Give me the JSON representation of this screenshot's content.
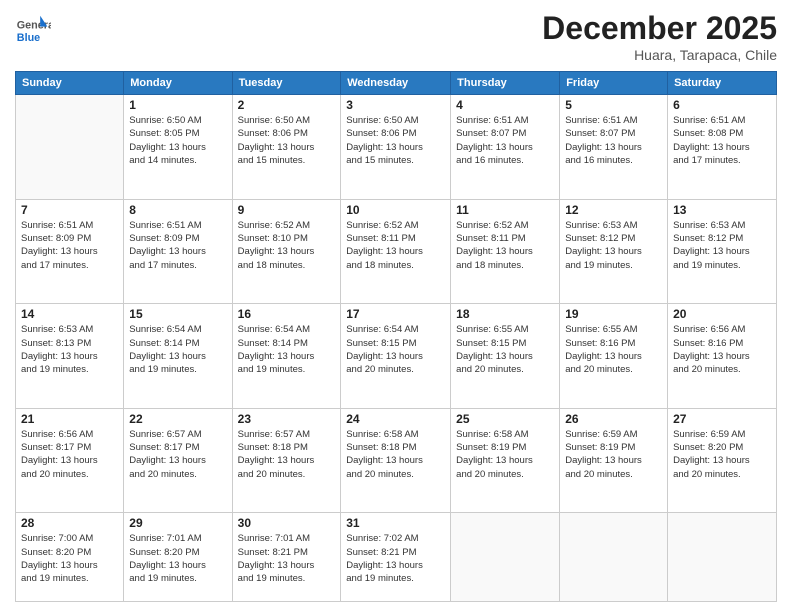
{
  "header": {
    "logo_general": "General",
    "logo_blue": "Blue",
    "month_title": "December 2025",
    "location": "Huara, Tarapaca, Chile"
  },
  "days_of_week": [
    "Sunday",
    "Monday",
    "Tuesday",
    "Wednesday",
    "Thursday",
    "Friday",
    "Saturday"
  ],
  "weeks": [
    [
      {
        "day": "",
        "info": ""
      },
      {
        "day": "1",
        "info": "Sunrise: 6:50 AM\nSunset: 8:05 PM\nDaylight: 13 hours\nand 14 minutes."
      },
      {
        "day": "2",
        "info": "Sunrise: 6:50 AM\nSunset: 8:06 PM\nDaylight: 13 hours\nand 15 minutes."
      },
      {
        "day": "3",
        "info": "Sunrise: 6:50 AM\nSunset: 8:06 PM\nDaylight: 13 hours\nand 15 minutes."
      },
      {
        "day": "4",
        "info": "Sunrise: 6:51 AM\nSunset: 8:07 PM\nDaylight: 13 hours\nand 16 minutes."
      },
      {
        "day": "5",
        "info": "Sunrise: 6:51 AM\nSunset: 8:07 PM\nDaylight: 13 hours\nand 16 minutes."
      },
      {
        "day": "6",
        "info": "Sunrise: 6:51 AM\nSunset: 8:08 PM\nDaylight: 13 hours\nand 17 minutes."
      }
    ],
    [
      {
        "day": "7",
        "info": "Sunrise: 6:51 AM\nSunset: 8:09 PM\nDaylight: 13 hours\nand 17 minutes."
      },
      {
        "day": "8",
        "info": "Sunrise: 6:51 AM\nSunset: 8:09 PM\nDaylight: 13 hours\nand 17 minutes."
      },
      {
        "day": "9",
        "info": "Sunrise: 6:52 AM\nSunset: 8:10 PM\nDaylight: 13 hours\nand 18 minutes."
      },
      {
        "day": "10",
        "info": "Sunrise: 6:52 AM\nSunset: 8:11 PM\nDaylight: 13 hours\nand 18 minutes."
      },
      {
        "day": "11",
        "info": "Sunrise: 6:52 AM\nSunset: 8:11 PM\nDaylight: 13 hours\nand 18 minutes."
      },
      {
        "day": "12",
        "info": "Sunrise: 6:53 AM\nSunset: 8:12 PM\nDaylight: 13 hours\nand 19 minutes."
      },
      {
        "day": "13",
        "info": "Sunrise: 6:53 AM\nSunset: 8:12 PM\nDaylight: 13 hours\nand 19 minutes."
      }
    ],
    [
      {
        "day": "14",
        "info": "Sunrise: 6:53 AM\nSunset: 8:13 PM\nDaylight: 13 hours\nand 19 minutes."
      },
      {
        "day": "15",
        "info": "Sunrise: 6:54 AM\nSunset: 8:14 PM\nDaylight: 13 hours\nand 19 minutes."
      },
      {
        "day": "16",
        "info": "Sunrise: 6:54 AM\nSunset: 8:14 PM\nDaylight: 13 hours\nand 19 minutes."
      },
      {
        "day": "17",
        "info": "Sunrise: 6:54 AM\nSunset: 8:15 PM\nDaylight: 13 hours\nand 20 minutes."
      },
      {
        "day": "18",
        "info": "Sunrise: 6:55 AM\nSunset: 8:15 PM\nDaylight: 13 hours\nand 20 minutes."
      },
      {
        "day": "19",
        "info": "Sunrise: 6:55 AM\nSunset: 8:16 PM\nDaylight: 13 hours\nand 20 minutes."
      },
      {
        "day": "20",
        "info": "Sunrise: 6:56 AM\nSunset: 8:16 PM\nDaylight: 13 hours\nand 20 minutes."
      }
    ],
    [
      {
        "day": "21",
        "info": "Sunrise: 6:56 AM\nSunset: 8:17 PM\nDaylight: 13 hours\nand 20 minutes."
      },
      {
        "day": "22",
        "info": "Sunrise: 6:57 AM\nSunset: 8:17 PM\nDaylight: 13 hours\nand 20 minutes."
      },
      {
        "day": "23",
        "info": "Sunrise: 6:57 AM\nSunset: 8:18 PM\nDaylight: 13 hours\nand 20 minutes."
      },
      {
        "day": "24",
        "info": "Sunrise: 6:58 AM\nSunset: 8:18 PM\nDaylight: 13 hours\nand 20 minutes."
      },
      {
        "day": "25",
        "info": "Sunrise: 6:58 AM\nSunset: 8:19 PM\nDaylight: 13 hours\nand 20 minutes."
      },
      {
        "day": "26",
        "info": "Sunrise: 6:59 AM\nSunset: 8:19 PM\nDaylight: 13 hours\nand 20 minutes."
      },
      {
        "day": "27",
        "info": "Sunrise: 6:59 AM\nSunset: 8:20 PM\nDaylight: 13 hours\nand 20 minutes."
      }
    ],
    [
      {
        "day": "28",
        "info": "Sunrise: 7:00 AM\nSunset: 8:20 PM\nDaylight: 13 hours\nand 19 minutes."
      },
      {
        "day": "29",
        "info": "Sunrise: 7:01 AM\nSunset: 8:20 PM\nDaylight: 13 hours\nand 19 minutes."
      },
      {
        "day": "30",
        "info": "Sunrise: 7:01 AM\nSunset: 8:21 PM\nDaylight: 13 hours\nand 19 minutes."
      },
      {
        "day": "31",
        "info": "Sunrise: 7:02 AM\nSunset: 8:21 PM\nDaylight: 13 hours\nand 19 minutes."
      },
      {
        "day": "",
        "info": ""
      },
      {
        "day": "",
        "info": ""
      },
      {
        "day": "",
        "info": ""
      }
    ]
  ]
}
